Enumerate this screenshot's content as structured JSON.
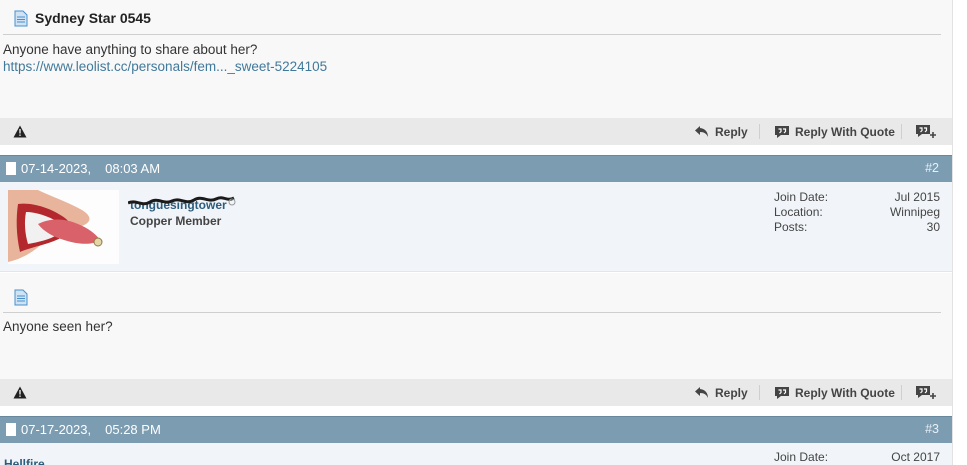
{
  "post1": {
    "title": "Sydney Star 0545",
    "text": "Anyone have anything to share about her?",
    "link": "https://www.leolist.cc/personals/fem..._sweet-5224105"
  },
  "actions": {
    "reply": "Reply",
    "reply_with_quote": "Reply With Quote"
  },
  "post2": {
    "date": "07-14-2023,",
    "time": "08:03 AM",
    "number": "#2",
    "username": "tonguesingtower",
    "user_title": "Copper Member",
    "join_label": "Join Date:",
    "join_value": "Jul 2015",
    "location_label": "Location:",
    "location_value": "Winnipeg",
    "posts_label": "Posts:",
    "posts_value": "30",
    "text": "Anyone seen her?"
  },
  "post3": {
    "date": "07-17-2023,",
    "time": "05:28 PM",
    "number": "#3",
    "username": "Hellfire",
    "join_label": "Join Date:",
    "join_value": "Oct 2017"
  },
  "colors": {
    "post_bar": "#7c9cb2",
    "link": "#41799a",
    "action_bar": "#e9e9e9"
  }
}
